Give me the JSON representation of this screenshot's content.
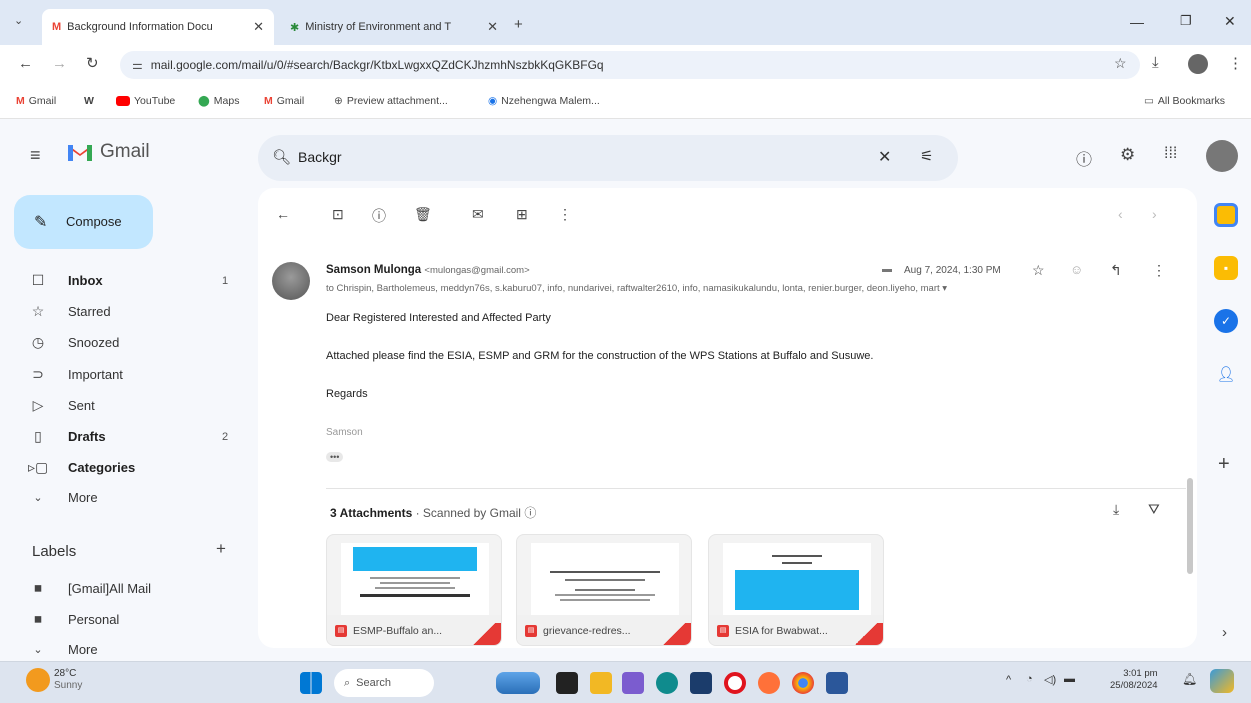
{
  "browser": {
    "tabs": [
      {
        "title": "Background Information Docu",
        "active": true,
        "icon": "gmail-icon"
      },
      {
        "title": "Ministry of Environment and T",
        "active": false,
        "icon": "ministry-icon"
      }
    ],
    "url": "mail.google.com/mail/u/0/#search/Backgr/KtbxLwgxxQZdCKJhzmhNszbkKqGKBFGq",
    "bookmarks": [
      {
        "label": "Gmail",
        "icon": "gmail-icon"
      },
      {
        "label": "W",
        "icon": "wikipedia-icon"
      },
      {
        "label": "YouTube",
        "icon": "youtube-icon"
      },
      {
        "label": "Maps",
        "icon": "maps-icon"
      },
      {
        "label": "Gmail",
        "icon": "gmail-icon"
      },
      {
        "label": "Preview attachment...",
        "icon": "globe-icon"
      },
      {
        "label": "Nzehengwa Malem...",
        "icon": "chrome-icon"
      }
    ],
    "all_bookmarks": "All Bookmarks"
  },
  "gmail": {
    "logo_text": "Gmail",
    "compose_label": "Compose",
    "nav": [
      {
        "label": "Inbox",
        "count": "1",
        "bold": true,
        "icon": "inbox-icon"
      },
      {
        "label": "Starred",
        "count": "",
        "bold": false,
        "icon": "star-icon"
      },
      {
        "label": "Snoozed",
        "count": "",
        "bold": false,
        "icon": "clock-icon"
      },
      {
        "label": "Important",
        "count": "",
        "bold": false,
        "icon": "important-icon"
      },
      {
        "label": "Sent",
        "count": "",
        "bold": false,
        "icon": "send-icon"
      },
      {
        "label": "Drafts",
        "count": "2",
        "bold": true,
        "icon": "draft-icon"
      },
      {
        "label": "Categories",
        "count": "",
        "bold": true,
        "icon": "label-icon"
      },
      {
        "label": "More",
        "count": "",
        "bold": false,
        "icon": "chevron-down-icon"
      }
    ],
    "labels_heading": "Labels",
    "labels": [
      {
        "label": "[Gmail]All Mail"
      },
      {
        "label": "Personal"
      },
      {
        "label": "More"
      }
    ],
    "search_value": "Backgr"
  },
  "email": {
    "sender_name": "Samson Mulonga",
    "sender_email": "<mulongas@gmail.com>",
    "recipients": "to Chrispin, Bartholemeus, meddyn76s, s.kaburu07, info, nundarivei, raftwalter2610, info, namasikukalundu, lonta, renier.burger, deon.liyeho, mart",
    "date": "Aug 7, 2024, 1:30 PM",
    "greeting": "Dear Registered Interested and Affected Party",
    "body": "Attached please find the ESIA, ESMP and GRM for the construction of the WPS Stations at Buffalo and Susuwe.",
    "closing": "Regards",
    "signature": "Samson",
    "ellipsis": "•••",
    "attachments_title": "3 Attachments",
    "scanned_label": "· Scanned by Gmail",
    "attachments": [
      {
        "name": "ESMP-Buffalo an..."
      },
      {
        "name": "grievance-redres..."
      },
      {
        "name": "ESIA for Bwabwat..."
      }
    ]
  },
  "taskbar": {
    "weather_temp": "28°C",
    "weather_desc": "Sunny",
    "search_placeholder": "Search",
    "time": "3:01 pm",
    "date": "25/08/2024"
  },
  "colors": {
    "compose_bg": "#c2e7ff",
    "search_bg": "#e9eef6",
    "gmail_red": "#ea4335",
    "attachment_blue": "#1fb4f0"
  }
}
